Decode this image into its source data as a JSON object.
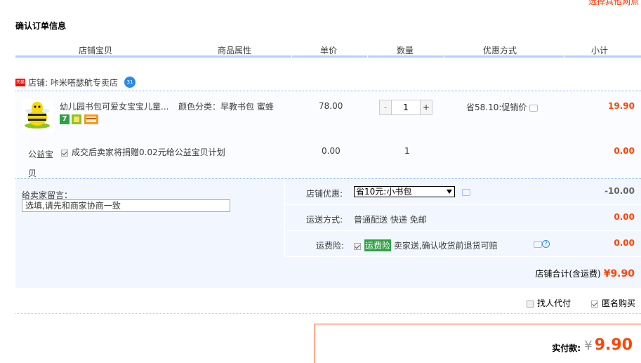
{
  "header": {
    "top_link": "选择其他网点",
    "section_title": "确认订单信息"
  },
  "table_headers": [
    "店铺宝贝",
    "商品属性",
    "单价",
    "数量",
    "优惠方式",
    "小计"
  ],
  "store": {
    "badge": "天猫",
    "label": "店铺: 咔米嗒瑟航专卖店",
    "ww_icon": "chat-bubble-icon"
  },
  "item": {
    "title": "幼儿园书包可爱女宝宝儿童...",
    "attributes": "颜色分类：早教书包 蜜蜂",
    "price": "78.00",
    "quantity": "1",
    "qty_minus": "-",
    "qty_plus": "+",
    "discount": "省58.10:促销价",
    "subtotal": "19.90",
    "service_icons": [
      "7-day-return-icon",
      "guarantee-icon",
      "credit-card-icon"
    ]
  },
  "charity": {
    "label": "公益宝贝",
    "text": "成交后卖家将捐赠0.02元给公益宝贝计划",
    "price": "0.00",
    "quantity": "1",
    "subtotal": "0.00"
  },
  "memo": {
    "label": "给卖家留言：",
    "placeholder": "选填,请先和商家协商一致"
  },
  "options": {
    "store_discount_label": "店铺优惠:",
    "store_discount_value": "省10元:小书包",
    "store_discount_amount": "-10.00",
    "shipping_label": "运送方式:",
    "shipping_value": "普通配送 快递 免邮",
    "shipping_amount": "0.00",
    "insurance_label": "运费险:",
    "insurance_tag": "运费险",
    "insurance_value": "卖家送,确认收货前退货可赔",
    "insurance_amount": "0.00"
  },
  "store_total": {
    "label": "店铺合计(含运费)",
    "amount": "¥9.90"
  },
  "checkout_options": {
    "proxy_pay": "找人代付",
    "anonymous": "匿名购买"
  },
  "payment": {
    "label": "实付款:",
    "currency": "¥",
    "amount": "9.90"
  },
  "colors": {
    "accent_blue": "#b2d1ff",
    "price_red": "#ff4400",
    "insurance_green": "#2ea143"
  }
}
